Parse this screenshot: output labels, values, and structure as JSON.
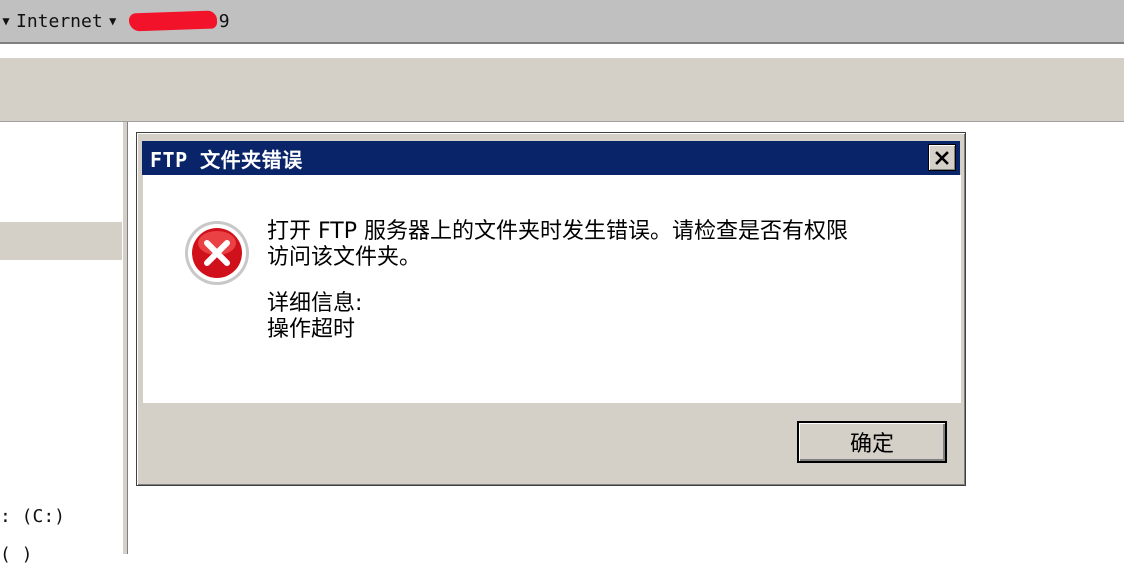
{
  "addressbar": {
    "text": "Internet",
    "suffix": "9"
  },
  "leftpane": {
    "drive_c": ": (C:)",
    "drive_next": "   (   )"
  },
  "dialog": {
    "title": "FTP 文件夹错误",
    "message_line1": "打开 FTP 服务器上的文件夹时发生错误。请检查是否有权限",
    "message_line2": "访问该文件夹。",
    "details_label": "详细信息:",
    "details_value": "操作超时",
    "ok_label": "确定",
    "icon": "error-icon",
    "close_icon": "close-icon"
  },
  "colors": {
    "titlebar": "#0a246a",
    "face": "#d4d0c8",
    "error_red": "#d0101a"
  }
}
